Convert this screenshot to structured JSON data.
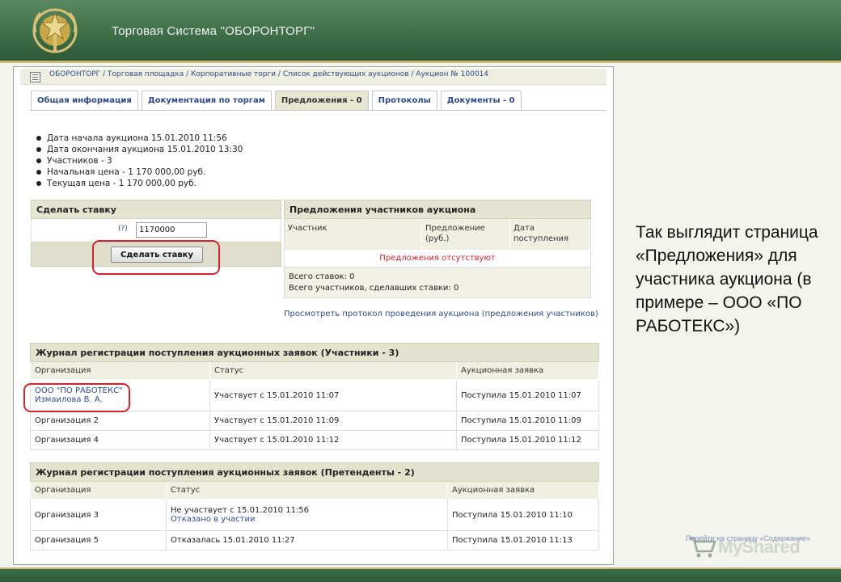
{
  "slide": {
    "title": "Торговая Система \"ОБОРОНТОРГ\"",
    "note": "Так выглядит страница «Предложения» для участника аукциона (в примере – ООО «ПО РАБОТЕКС»)",
    "footer_link": "Перейти на страницу «Содержание»",
    "watermark": "MyShared",
    "colors": {
      "band": "#3f6f48",
      "accent": "#c9b87a",
      "highlight": "#d4232e"
    }
  },
  "breadcrumb": "ОБОРОНТОРГ / Торговая площадка / Корпоративные торги / Список действующих аукционов / Аукцион № 100014",
  "tabs": [
    {
      "label": "Общая информация",
      "active": false
    },
    {
      "label": "Документация по торгам",
      "active": false
    },
    {
      "label": "Предложения - 0",
      "active": true
    },
    {
      "label": "Протоколы",
      "active": false
    },
    {
      "label": "Документы - 0",
      "active": false
    }
  ],
  "facts": [
    "Дата начала аукциона 15.01.2010 11:56",
    "Дата окончания аукциона 15.01.2010 13:30",
    "Участников - 3",
    "Начальная цена - 1 170 000,00 руб.",
    "Текущая цена - 1 170 000,00 руб."
  ],
  "bid": {
    "title": "Сделать ставку",
    "help": "(?)",
    "value": "1170000",
    "button": "Сделать ставку"
  },
  "offers": {
    "title": "Предложения участников аукциона",
    "columns": [
      "Участник",
      "Предложение (руб.)",
      "Дата поступления"
    ],
    "empty": "Предложения отсутствуют",
    "total_bids": "Всего ставок: 0",
    "total_participants": "Всего участников, сделавших ставки: 0",
    "protocol_link": "Просмотреть протокол проведения аукциона (предложения участников)"
  },
  "journal_participants": {
    "title": "Журнал регистрации поступления аукционных заявок (Участники - 3)",
    "columns": [
      "Организация",
      "Статус",
      "Аукционная заявка"
    ],
    "rows": [
      {
        "org": "ООО \"ПО РАБОТЕКС\"",
        "person": "Измаилова В. А.",
        "status": "Участвует с 15.01.2010 11:07",
        "app": "Поступила 15.01.2010 11:07"
      },
      {
        "org": "Организация 2",
        "status": "Участвует с 15.01.2010 11:09",
        "app": "Поступила 15.01.2010 11:09"
      },
      {
        "org": "Организация 4",
        "status": "Участвует с 15.01.2010 11:12",
        "app": "Поступила 15.01.2010 11:12"
      }
    ]
  },
  "journal_applicants": {
    "title": "Журнал регистрации поступления аукционных заявок (Претенденты - 2)",
    "columns": [
      "Организация",
      "Статус",
      "Аукционная заявка"
    ],
    "rows": [
      {
        "org": "Организация 3",
        "status": "Не участвует с 15.01.2010 11:56",
        "status2": "Отказано в участии",
        "app": "Поступила 15.01.2010 11:10"
      },
      {
        "org": "Организация 5",
        "status": "Отказалась 15.01.2010 11:27",
        "app": "Поступила 15.01.2010 11:13"
      }
    ]
  }
}
